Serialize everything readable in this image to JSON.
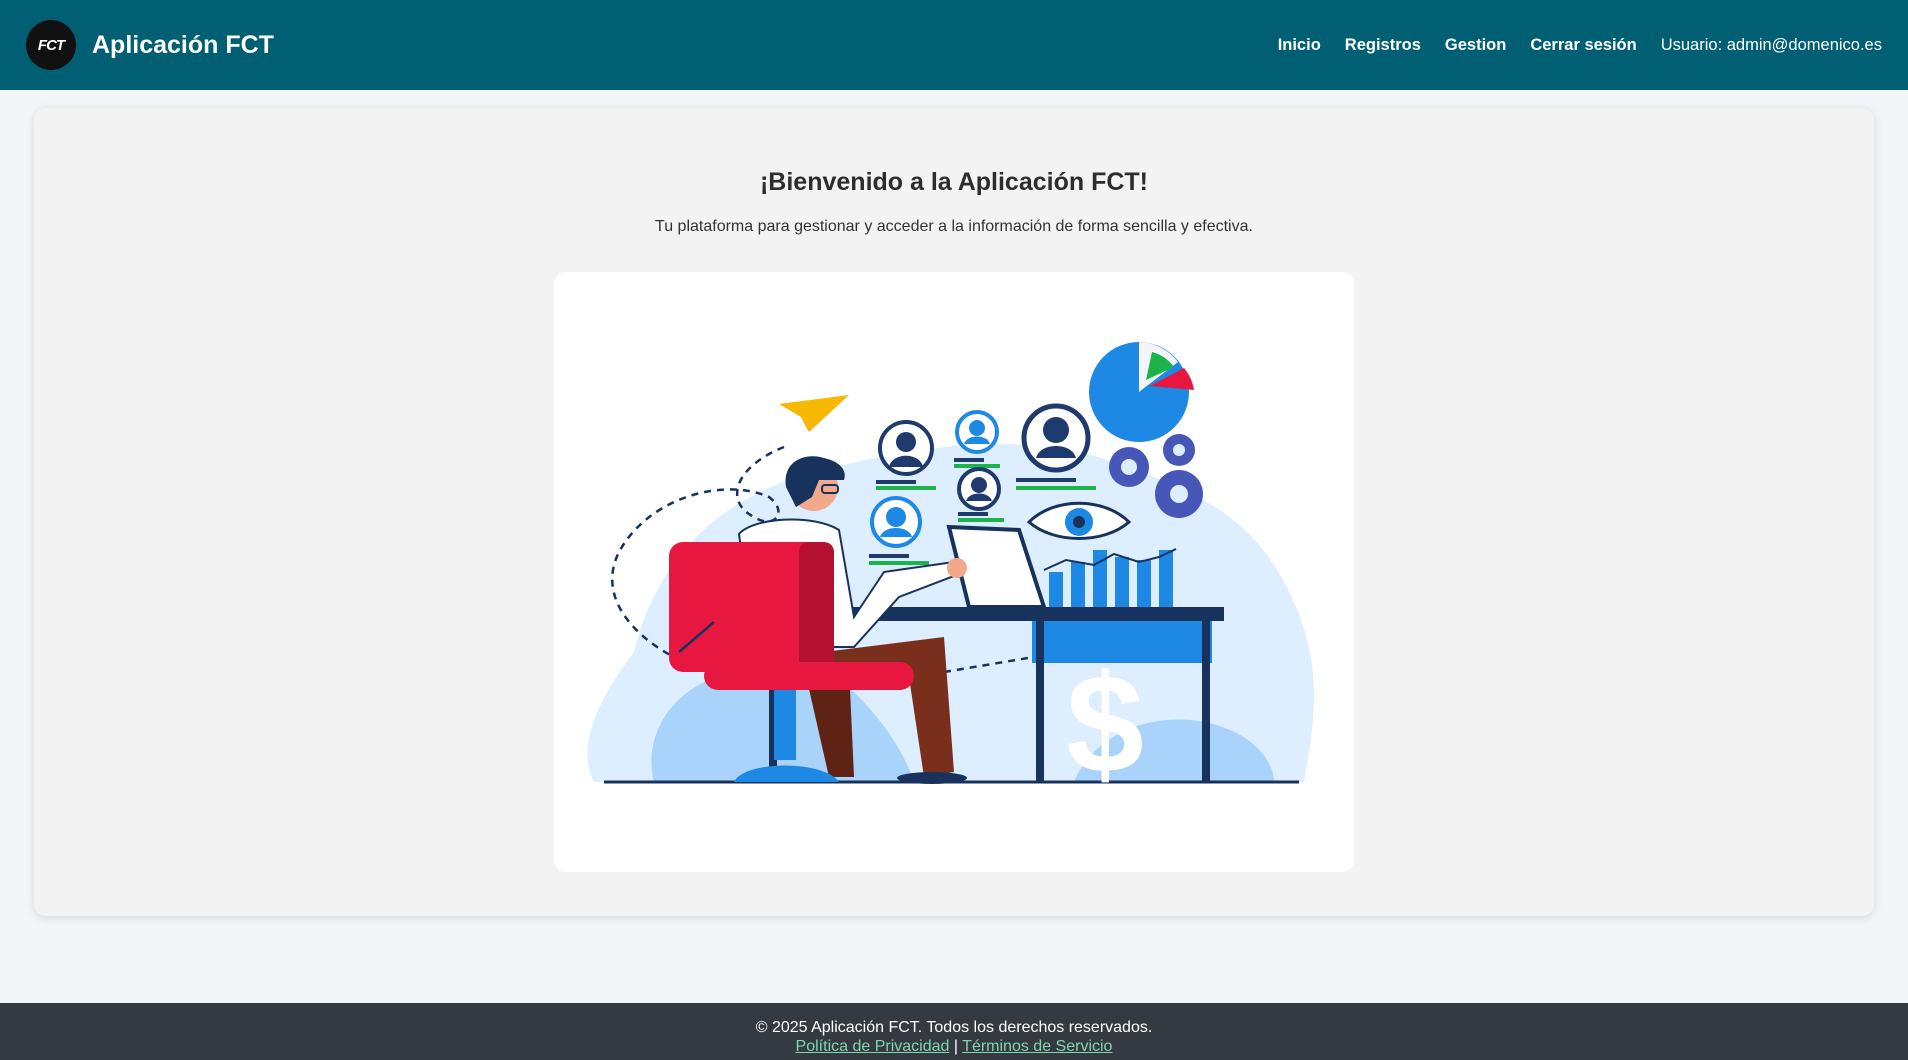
{
  "header": {
    "logo_text": "FCT",
    "title": "Aplicación FCT",
    "nav": {
      "inicio": "Inicio",
      "registros": "Registros",
      "gestion": "Gestion",
      "logout": "Cerrar sesión"
    },
    "user_label": "Usuario: admin@domenico.es"
  },
  "main": {
    "heading": "¡Bienvenido a la Aplicación FCT!",
    "subtitle": "Tu plataforma para gestionar y acceder a la información de forma sencilla y efectiva.",
    "illustration": "person-at-desk-analytics-illustration"
  },
  "footer": {
    "copyright": "© 2025 Aplicación FCT. Todos los derechos reservados.",
    "privacy_link": "Política de Privacidad",
    "separator": "|",
    "terms_link": "Términos de Servicio"
  },
  "colors": {
    "header_bg": "#015f73",
    "footer_bg": "#343a40",
    "accent_blue": "#1e88e5",
    "accent_red": "#e8173f",
    "accent_green": "#1bb34a",
    "accent_yellow": "#f6b800"
  }
}
